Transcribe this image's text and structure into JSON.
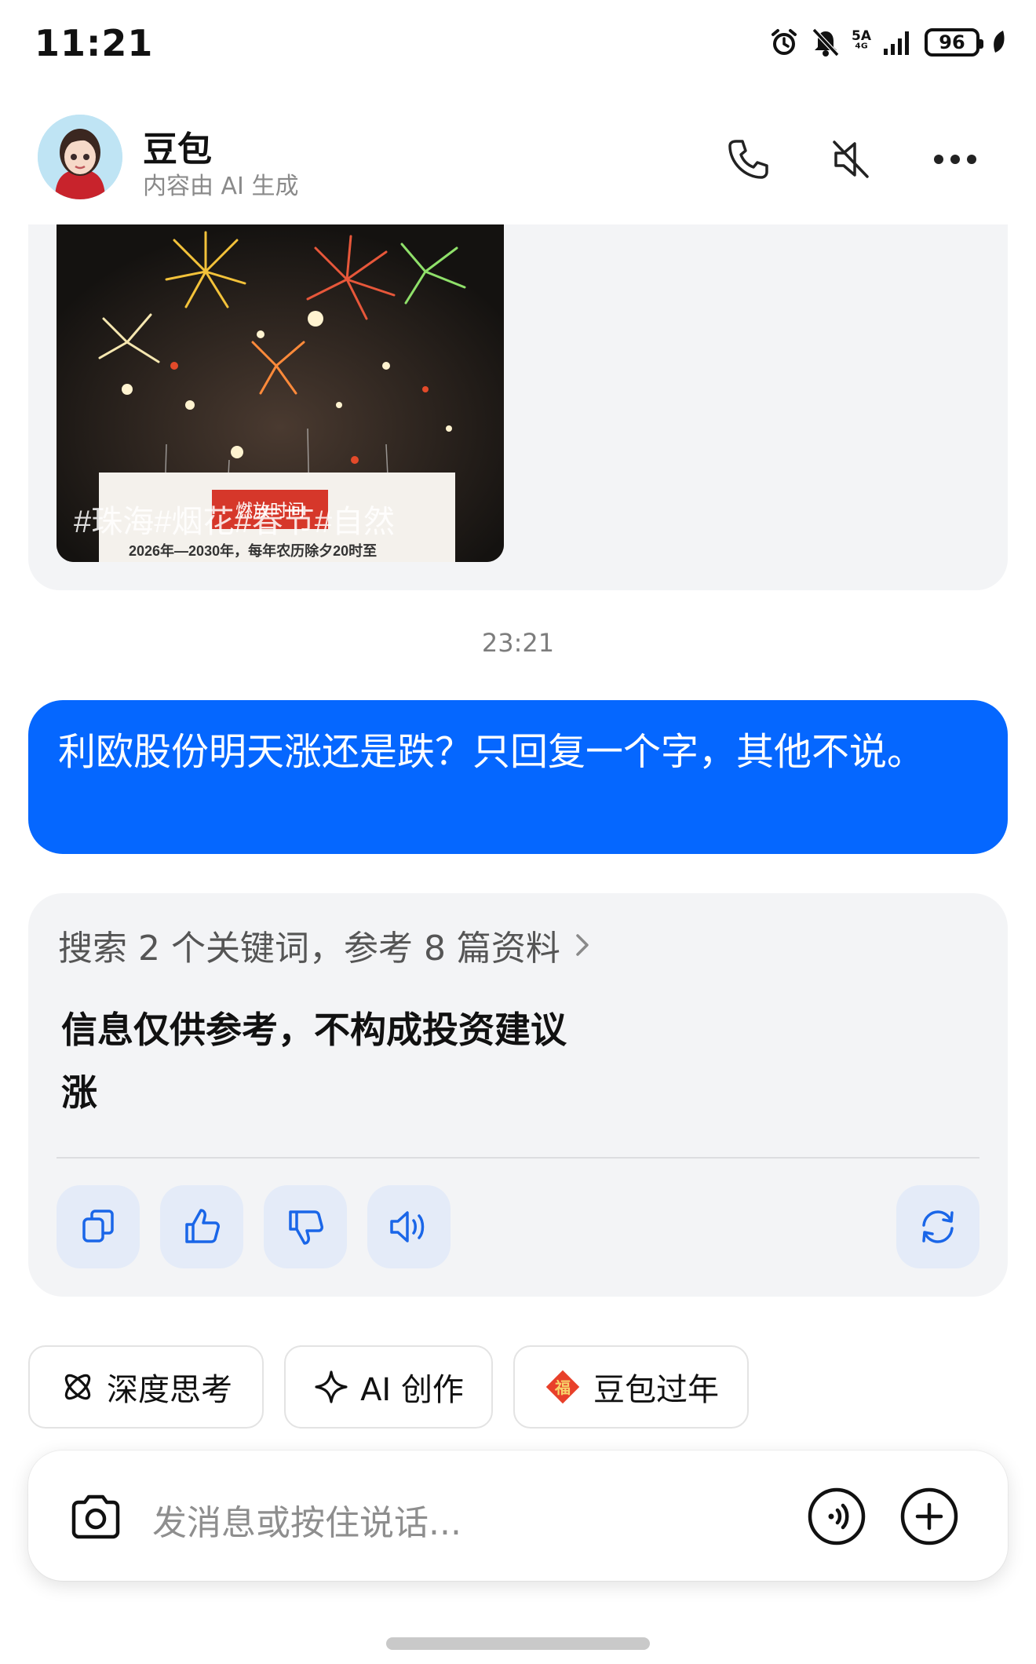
{
  "status_bar": {
    "time": "11:21",
    "network": "5A",
    "battery": "96"
  },
  "header": {
    "title": "豆包",
    "subtitle": "内容由 AI 生成"
  },
  "media": {
    "overlay_text": "#珠海#烟花#春节#自然",
    "sign_header": "燃放时间",
    "sign_text": "2026年—2030年，每年农历除夕20时至"
  },
  "timestamp": "23:21",
  "user_message": "利欧股份明天涨还是跌？只回复一个字，其他不说。",
  "answer": {
    "search_summary": "搜索 2 个关键词，参考 8 篇资料",
    "disclaimer": "信息仅供参考，不构成投资建议",
    "reply": "涨"
  },
  "chips": [
    {
      "label": "深度思考",
      "icon": "atom-icon"
    },
    {
      "label": "AI 创作",
      "icon": "sparkle-icon"
    },
    {
      "label": "豆包过年",
      "icon": "fu-icon"
    }
  ],
  "input": {
    "placeholder": "发消息或按住说话..."
  },
  "colors": {
    "accent": "#0567ff",
    "bubble_gray": "#f3f4f6",
    "action_bg": "#e4ebf8",
    "action_icon": "#1a66e8",
    "fu_red": "#e8402a"
  }
}
